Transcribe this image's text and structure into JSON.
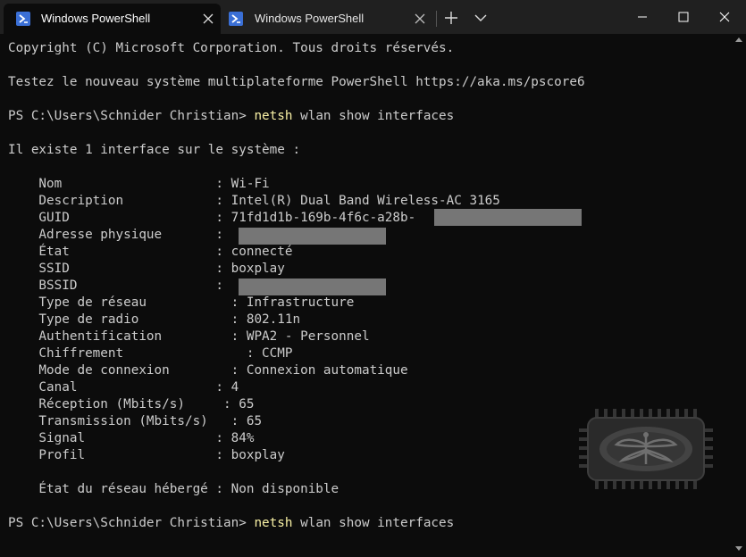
{
  "tabs": [
    {
      "title": "Windows PowerShell",
      "icon": "powershell-icon",
      "active": true
    },
    {
      "title": "Windows PowerShell",
      "icon": "powershell-icon",
      "active": false
    }
  ],
  "tabbar": {
    "new_tab_icon": "plus-icon",
    "dropdown_icon": "chevron-down-icon"
  },
  "window_controls": [
    "minimize-icon",
    "maximize-icon",
    "close-icon"
  ],
  "terminal": {
    "copyright": "Copyright (C) Microsoft Corporation. Tous droits réservés.",
    "try_new": "Testez le nouveau système multiplateforme PowerShell https://aka.ms/pscore6",
    "prompt": "PS C:\\Users\\Schnider Christian> ",
    "cmd_name": "netsh",
    "cmd_args": " wlan show interfaces",
    "intro": "Il existe 1 interface sur le système :",
    "fields": [
      {
        "label": "    Nom                    : ",
        "value": "Wi-Fi"
      },
      {
        "label": "    Description            : ",
        "value": "Intel(R) Dual Band Wireless-AC 3165"
      },
      {
        "label": "    GUID                   : ",
        "value": "71fd1d1b-169b-4f6c-a28b-"
      },
      {
        "label": "    Adresse physique       : ",
        "value": ""
      },
      {
        "label": "    État                   : ",
        "value": "connecté"
      },
      {
        "label": "    SSID                   : ",
        "value": "boxplay"
      },
      {
        "label": "    BSSID                  : ",
        "value": ""
      },
      {
        "label": "    Type de réseau           : ",
        "value": "Infrastructure"
      },
      {
        "label": "    Type de radio            : ",
        "value": "802.11n"
      },
      {
        "label": "    Authentification         : ",
        "value": "WPA2 - Personnel"
      },
      {
        "label": "    Chiffrement                : ",
        "value": "CCMP"
      },
      {
        "label": "    Mode de connexion        : ",
        "value": "Connexion automatique"
      },
      {
        "label": "    Canal                  : ",
        "value": "4"
      },
      {
        "label": "    Réception (Mbits/s)     : ",
        "value": "65"
      },
      {
        "label": "    Transmission (Mbits/s)   : ",
        "value": "65"
      },
      {
        "label": "    Signal                 : ",
        "value": "84%"
      },
      {
        "label": "    Profil                 : ",
        "value": "boxplay"
      }
    ],
    "hosted": "    État du réseau hébergé : Non disponible"
  },
  "colors": {
    "background": "#0c0c0c",
    "text": "#cccccc",
    "command": "#f9f1a5",
    "tabbar": "#202020",
    "redaction": "#767676"
  }
}
